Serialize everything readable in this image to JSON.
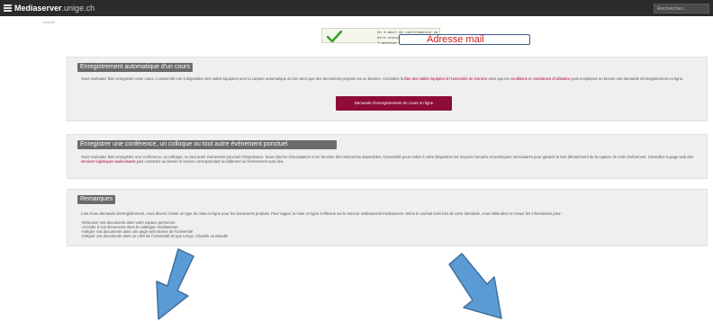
{
  "header": {
    "brand_bold": "Mediaserver",
    "brand_domain": ".unige.ch",
    "search_placeholder": "Rechercher..."
  },
  "breadcrumb": "Accueil",
  "notice": {
    "line1": "Un e-mail de confirmation va être envoyé à",
    "line2": "l'adresse suivante:"
  },
  "callout": {
    "label": "Adresse mail",
    "text_color": "#c81e1e",
    "border_color": "#3c5a8a"
  },
  "panels": {
    "auto": {
      "title": "Enregistrement automatique d'un cours",
      "text_part1": "Vous souhaitez faire enregistrer votre cours. L'université met à disposition des salles équipées pour la capture automatique du son ainsi que des documents projetés via un beamer. Consultez la ",
      "link1": "liste des salles équipées à l'Université de Genève",
      "text_part2": " ainsi que les ",
      "link2": "conditions et contraintes d'utilisation",
      "text_part3": " puis remplissez au besoin une demande d'enregistrement en ligne.",
      "button_label": "Demande d'enregistrement de cours en ligne"
    },
    "conference": {
      "title": "Enregistrer une conférence, un colloque ou tout autre événement ponctuel",
      "text_part1": "Vous souhaitez faire enregistrer une conférence, un colloque, ou tout autre événement ponctuel d'importance. Sous réserve d'acceptation et en fonction des ressources disponibles, l'Université peut mettre à votre disposition les moyens humains et techniques nécessaires pour garantir le bon déroulement de la capture de votre événement. Consultez la page web des ",
      "link": "services logistiques audiovisuels",
      "text_part2": " puis contactez au besoin le service correspondant au bâtiment où l'événement aura lieu."
    },
    "remarks": {
      "title": "Remarques",
      "intro": "Lors d'une demande d'enregistrement, vous devrez choisir un type de mise en ligne pour les documents produits. Pour rappel, la mise en ligne s'effectue sur le serveur institutionnel mediaserver. Selon le souhait émis lors de votre demande, vous obtiendrez en retour les informations pour:",
      "items": [
        "-Retrouver vos documents dans votre espace personnel.",
        "-Accéder à vos documents dans le catalogue mediaserver.",
        "-Intégrer vos documents dans une page web interne de l'Université",
        "-Intégrer vos documents dans un LMS de l'Université tel que Lenya, Chamilo ou Moodle"
      ]
    }
  },
  "colors": {
    "topbar": "#2b2b2b",
    "button": "#8e0b3a",
    "panel_title": "#6b6b6b",
    "link": "#b0003a",
    "arrow_fill": "#5b9bd5",
    "arrow_stroke": "#41719c",
    "check": "#3aa12b"
  },
  "icons": {
    "menu": "hamburger-menu-icon",
    "check": "check-icon",
    "arrows": "arrow-down-left-icon, arrow-down-right-icon"
  }
}
